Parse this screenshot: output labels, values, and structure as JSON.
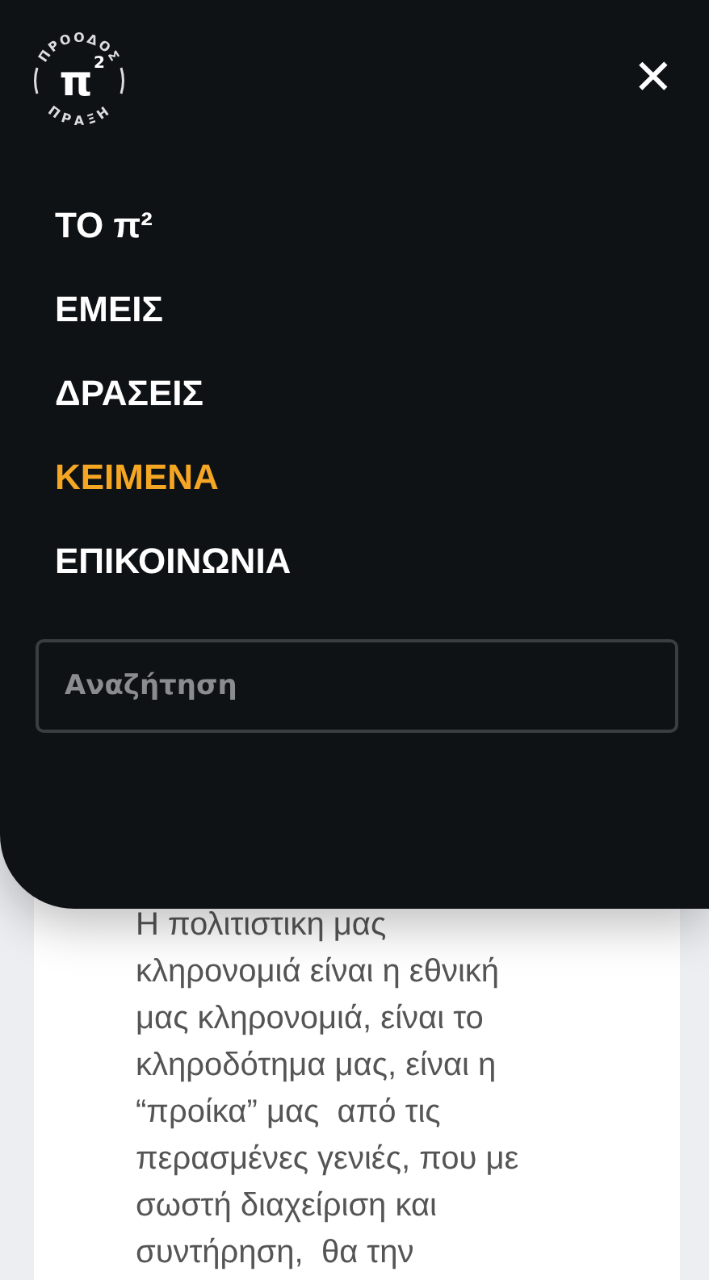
{
  "logo": {
    "top": "ΠΡΟΟΔΟΣ",
    "mark": "π",
    "sup": "2",
    "bottom": "ΠΡΑΞΗ"
  },
  "close": {
    "glyph": "✕"
  },
  "menu": [
    {
      "label": "ΤΟ π²",
      "selected": false
    },
    {
      "label": "ΕΜΕΙΣ",
      "selected": false
    },
    {
      "label": "ΔΡΑΣΕΙΣ",
      "selected": false
    },
    {
      "label": "ΚΕΙΜΕΝΑ",
      "selected": true
    },
    {
      "label": "ΕΠΙΚΟΙΝΩΝΙΑ",
      "selected": false
    }
  ],
  "search": {
    "placeholder": "Αναζήτηση"
  },
  "article": {
    "lines": [
      "Η πολιτιστικη μας",
      "κληρονομιά είναι η εθνική",
      "μας κληρονομιά, είναι το",
      "κληροδότημα μας, είναι η",
      "“προίκα” μας  από τις",
      "περασμένες γενιές, που με",
      "σωστή διαχείριση και",
      "συντήρηση,  θα την"
    ]
  }
}
